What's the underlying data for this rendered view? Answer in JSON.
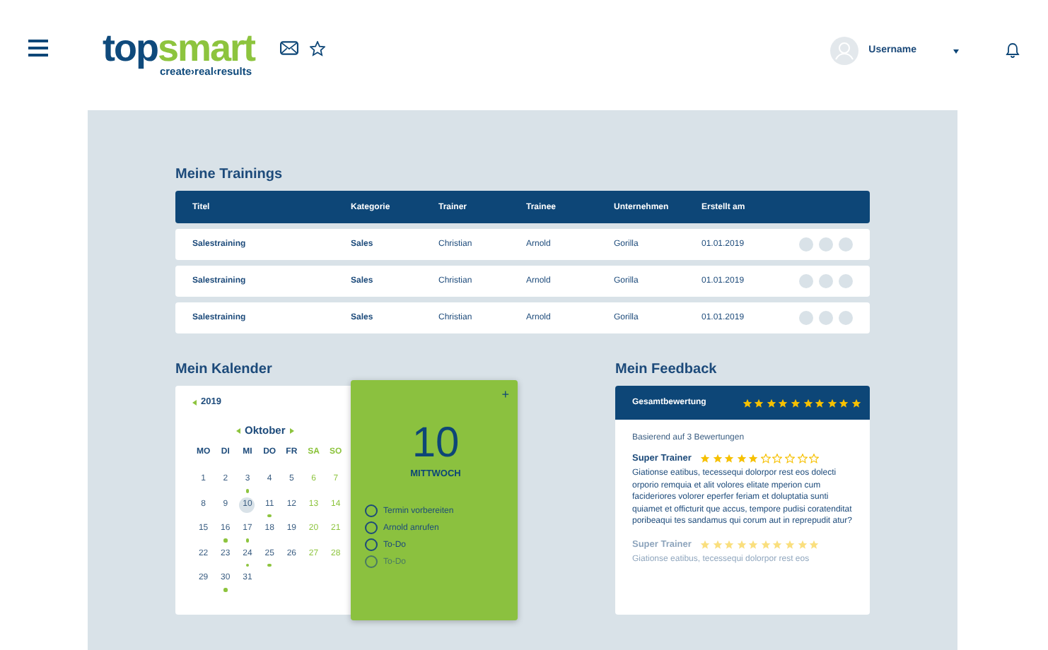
{
  "header": {
    "logo": {
      "word_dark": "top",
      "word_green": "smart",
      "tagline": "create›real‹results"
    },
    "user": {
      "name": "Username"
    }
  },
  "trainings": {
    "title": "Meine Trainings",
    "columns": [
      "Titel",
      "Kategorie",
      "Trainer",
      "Trainee",
      "Unternehmen",
      "Erstellt am"
    ],
    "rows": [
      {
        "cells": [
          "Salestraining",
          "Sales",
          "Christian",
          "Arnold",
          "Gorilla",
          "01.01.2019"
        ]
      },
      {
        "cells": [
          "Salestraining",
          "Sales",
          "Christian",
          "Arnold",
          "Gorilla",
          "01.01.2019"
        ]
      },
      {
        "cells": [
          "Salestraining",
          "Sales",
          "Christian",
          "Arnold",
          "Gorilla",
          "01.01.2019"
        ]
      }
    ]
  },
  "calendar": {
    "title": "Mein Kalender",
    "year": "2019",
    "month": "Oktober",
    "weekdays": [
      {
        "label": "MO",
        "weekend": false
      },
      {
        "label": "DI",
        "weekend": false
      },
      {
        "label": "MI",
        "weekend": false
      },
      {
        "label": "DO",
        "weekend": false
      },
      {
        "label": "FR",
        "weekend": false
      },
      {
        "label": "SA",
        "weekend": true
      },
      {
        "label": "SO",
        "weekend": true
      }
    ],
    "weeks": [
      [
        {
          "day": "1",
          "event": false,
          "selected": false
        },
        {
          "day": "2",
          "event": false,
          "selected": false
        },
        {
          "day": "3",
          "event": true,
          "selected": false
        },
        {
          "day": "4",
          "event": false,
          "selected": false
        },
        {
          "day": "5",
          "event": false,
          "selected": false
        },
        {
          "day": "6",
          "event": false,
          "selected": false
        },
        {
          "day": "7",
          "event": false,
          "selected": false
        }
      ],
      [
        {
          "day": "8",
          "event": false,
          "selected": false
        },
        {
          "day": "9",
          "event": false,
          "selected": false
        },
        {
          "day": "10",
          "event": false,
          "selected": true
        },
        {
          "day": "11",
          "event": true,
          "selected": false
        },
        {
          "day": "12",
          "event": false,
          "selected": false
        },
        {
          "day": "13",
          "event": false,
          "selected": false
        },
        {
          "day": "14",
          "event": false,
          "selected": false
        }
      ],
      [
        {
          "day": "15",
          "event": false,
          "selected": false
        },
        {
          "day": "16",
          "event": true,
          "selected": false
        },
        {
          "day": "17",
          "event": true,
          "selected": false
        },
        {
          "day": "18",
          "event": false,
          "selected": false
        },
        {
          "day": "19",
          "event": false,
          "selected": false
        },
        {
          "day": "20",
          "event": false,
          "selected": false
        },
        {
          "day": "21",
          "event": false,
          "selected": false
        }
      ],
      [
        {
          "day": "22",
          "event": false,
          "selected": false
        },
        {
          "day": "23",
          "event": false,
          "selected": false
        },
        {
          "day": "24",
          "event": true,
          "selected": false
        },
        {
          "day": "25",
          "event": true,
          "selected": false
        },
        {
          "day": "26",
          "event": false,
          "selected": false
        },
        {
          "day": "27",
          "event": false,
          "selected": false
        },
        {
          "day": "28",
          "event": false,
          "selected": false
        }
      ],
      [
        {
          "day": "29",
          "event": false,
          "selected": false
        },
        {
          "day": "30",
          "event": true,
          "selected": false
        },
        {
          "day": "31",
          "event": false,
          "selected": false
        }
      ]
    ],
    "day_card": {
      "add": "+",
      "day": "10",
      "weekday": "MITTWOCH",
      "todos": [
        {
          "label": "Termin vorbereiten",
          "checked": false,
          "faded": false
        },
        {
          "label": "Arnold anrufen",
          "checked": false,
          "faded": false
        },
        {
          "label": "To-Do",
          "checked": false,
          "faded": false
        },
        {
          "label": "To-Do",
          "checked": false,
          "faded": true
        }
      ]
    }
  },
  "feedback": {
    "title": "Mein Feedback",
    "overall": {
      "label": "Gesamtbewertung",
      "stars": 10
    },
    "summary": "Basierend auf 3 Bewertungen",
    "reviews": [
      {
        "name": "Super Trainer",
        "stars": 5,
        "faded": false,
        "text": "Giationse eatibus, tecessequi dolorpor rest eos dolecti orporio remquia et alit volores elitate mperion cum facideriores volorer eperfer feriam et doluptatia sunti quiamet et officturit que accus, tempore pudisi coratenditat poribeaqui tes sandamus qui corum aut in reprepudit atur?"
      },
      {
        "name": "Super Trainer",
        "stars": 10,
        "faded": true,
        "text": "Giationse eatibus, tecessequi dolorpor rest eos"
      }
    ]
  }
}
